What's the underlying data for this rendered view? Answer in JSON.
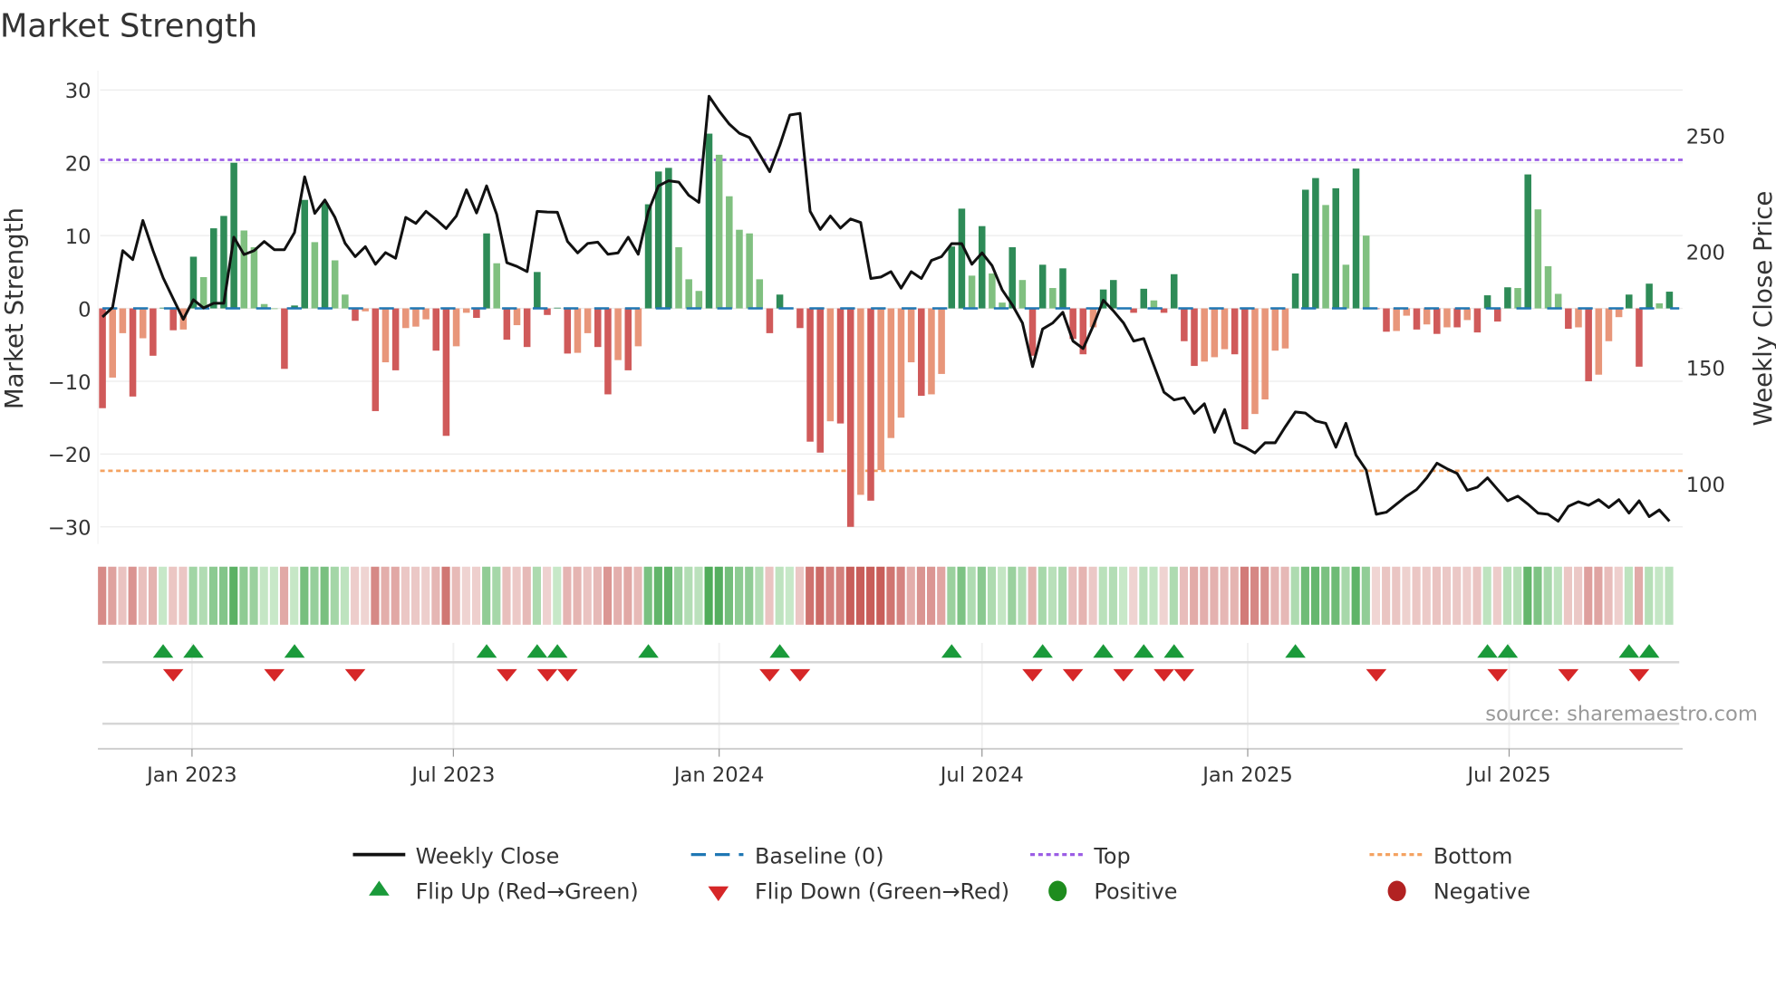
{
  "chart_data": {
    "type": "bar",
    "title": "Market Strength",
    "ylabel": "Market Strength",
    "y2label": "Weekly Close Price",
    "source": "source: sharemaestro.com",
    "ylim": [
      -32,
      32
    ],
    "y2lim": [
      78,
      273
    ],
    "yticks": [
      -30,
      -20,
      -10,
      0,
      10,
      20,
      30
    ],
    "ytick_labels": [
      "−30",
      "−20",
      "−10",
      "0",
      "10",
      "20",
      "30"
    ],
    "y2ticks": [
      100,
      150,
      200,
      250
    ],
    "y2tick_labels": [
      "100",
      "150",
      "200",
      "250"
    ],
    "x_start": "2022-10-31",
    "x_step_days": 7,
    "xticks": [
      {
        "date": "2023-01-01",
        "label": "Jan 2023"
      },
      {
        "date": "2023-07-01",
        "label": "Jul 2023"
      },
      {
        "date": "2024-01-01",
        "label": "Jan 2024"
      },
      {
        "date": "2024-07-01",
        "label": "Jul 2024"
      },
      {
        "date": "2025-01-01",
        "label": "Jan 2025"
      },
      {
        "date": "2025-07-01",
        "label": "Jul 2025"
      }
    ],
    "top_level": 20.4,
    "bottom_level": -22.3,
    "baseline": 0,
    "strength": [
      -13.7,
      -9.5,
      -3.4,
      -12.1,
      -4.1,
      -6.5,
      0.1,
      -3.0,
      -2.9,
      7.1,
      4.3,
      11,
      12.7,
      20,
      10.7,
      8.4,
      0.6,
      0,
      -8.3,
      0.4,
      14.9,
      9.1,
      14.5,
      6.6,
      1.9,
      -1.7,
      -0.4,
      -14.1,
      -7.4,
      -8.5,
      -2.7,
      -2.5,
      -1.5,
      -5.8,
      -17.5,
      -5.2,
      -0.6,
      -1.3,
      10.3,
      6.2,
      -4.3,
      -2.3,
      -5.3,
      5.0,
      -0.9,
      0.1,
      -6.2,
      -6.1,
      -3.4,
      -5.3,
      -11.8,
      -7.1,
      -8.5,
      -5.2,
      14.3,
      18.8,
      19.3,
      8.4,
      4.0,
      2.4,
      24.0,
      21.1,
      15.4,
      10.8,
      10.3,
      4.0,
      -3.4,
      1.9,
      0.1,
      -2.7,
      -18.3,
      -19.8,
      -15.5,
      -15.8,
      -30,
      -25.6,
      -26.4,
      -22.2,
      -17.8,
      -15,
      -7.4,
      -12,
      -11.8,
      -9,
      8.5,
      13.7,
      4.5,
      11.3,
      4.8,
      0.8,
      8.4,
      3.9,
      -6.5,
      6.0,
      2.8,
      5.5,
      -4.2,
      -6.3,
      -2.6,
      2.6,
      3.9,
      0,
      -0.6,
      2.7,
      1.1,
      -0.6,
      4.7,
      -4.5,
      -7.9,
      -7.3,
      -6.7,
      -5.6,
      -6.3,
      -16.6,
      -14.5,
      -12.5,
      -5.8,
      -5.5,
      4.8,
      16.3,
      17.9,
      14.2,
      16.5,
      6.0,
      19.2,
      10.0,
      -0.1,
      -3.2,
      -3.1,
      -1,
      -2.9,
      -2.2,
      -3.5,
      -2.6,
      -2.6,
      -1.6,
      -3.3,
      1.8,
      -1.8,
      2.9,
      2.8,
      18.4,
      13.6,
      5.8,
      2.0,
      -2.8,
      -2.6,
      -10,
      -9.1,
      -4.5,
      -1.2,
      1.9,
      -8,
      3.4,
      0.7,
      2.3
    ],
    "weekly_close": [
      171.8,
      176,
      200.4,
      196.5,
      213.4,
      200.4,
      188.7,
      179.6,
      170.8,
      179.2,
      175.7,
      177.7,
      177.7,
      206.2,
      198.7,
      200.4,
      204.3,
      200.8,
      200.8,
      208.2,
      232.2,
      216.4,
      222.2,
      214.7,
      203.6,
      197.8,
      202.1,
      194.5,
      199.5,
      197.1,
      214.7,
      212.1,
      217.3,
      213.8,
      209.9,
      215.3,
      226.6,
      216.6,
      228.3,
      216,
      195.2,
      193.6,
      191.3,
      217.3,
      217,
      216.9,
      204.3,
      199.4,
      203.5,
      204,
      198.8,
      199.4,
      206.2,
      198.8,
      217.3,
      228.3,
      230.5,
      229.9,
      224.2,
      221.2,
      266.9,
      260.5,
      254.9,
      251,
      249.1,
      241.9,
      234.4,
      245.8,
      258.8,
      259.5,
      217.3,
      209.5,
      215.3,
      210.1,
      214,
      212.5,
      188.4,
      189,
      191.3,
      184.2,
      191.3,
      188.4,
      196.2,
      197.8,
      203.4,
      203.4,
      194.5,
      199.4,
      193.9,
      183.5,
      177,
      169.2,
      150.4,
      166.6,
      169.2,
      173.8,
      161.4,
      158.2,
      167.9,
      179,
      174.4,
      169.2,
      161.4,
      162.5,
      151,
      139.4,
      136.1,
      137,
      130.3,
      134.4,
      122.1,
      131.9,
      117.6,
      115.7,
      113.2,
      117.6,
      117.6,
      124.5,
      130.9,
      130.4,
      127,
      126,
      115.7,
      126,
      112.3,
      105.9,
      86.8,
      87.7,
      91.2,
      94.6,
      97.5,
      102.5,
      108.8,
      106.4,
      104.4,
      97.1,
      98.5,
      102.5,
      97.5,
      92.6,
      94.6,
      91.2,
      87.3,
      86.8,
      83.8,
      90.2,
      92.2,
      90.7,
      93.1,
      89.7,
      93.1,
      87.3,
      92.6,
      85.8,
      88.7,
      83.8
    ],
    "flip_up_weeks": [
      6,
      9,
      19,
      38,
      43,
      45,
      54,
      67,
      84,
      93,
      99,
      103,
      106,
      118,
      137,
      139,
      151,
      153
    ],
    "flip_down_weeks": [
      7,
      17,
      25,
      40,
      44,
      46,
      66,
      69,
      92,
      96,
      101,
      105,
      107,
      126,
      138,
      145,
      152
    ],
    "legend": {
      "weekly_close": "Weekly Close",
      "baseline": "Baseline (0)",
      "top": "Top",
      "bottom": "Bottom",
      "flip_up": "Flip Up (Red→Green)",
      "flip_down": "Flip Down (Green→Red)",
      "positive": "Positive",
      "negative": "Negative"
    },
    "legend_position": "bottom",
    "colors": {
      "up_strong": "#2e8b57",
      "up_weak": "#80c080",
      "down_strong": "#d05a5a",
      "down_weak": "#e8967a",
      "line": "#111111",
      "baseline": "#1f77b4",
      "top": "#9b5de5",
      "bottom": "#f4a261",
      "flip_up": "#1a9a3a",
      "flip_down": "#d62728",
      "positive": "#1e8c1e",
      "negative": "#b22222"
    }
  }
}
